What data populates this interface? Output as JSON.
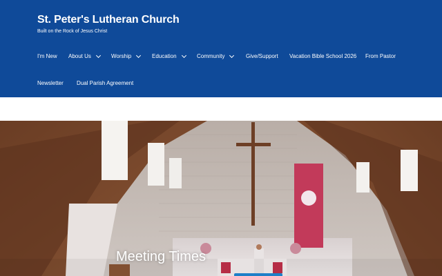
{
  "site": {
    "title": "St. Peter's Lutheran Church",
    "tagline": "Built on the Rock of Jesus Christ"
  },
  "nav": {
    "items": [
      {
        "label": "I'm New",
        "has_submenu": false
      },
      {
        "label": "About Us",
        "has_submenu": true
      },
      {
        "label": "Worship",
        "has_submenu": true
      },
      {
        "label": "Education",
        "has_submenu": true
      },
      {
        "label": "Community",
        "has_submenu": true
      },
      {
        "label": "Give/Support",
        "has_submenu": false
      },
      {
        "label": "Vacation Bible School 2026",
        "has_submenu": false
      },
      {
        "label": "From Pastor",
        "has_submenu": false
      },
      {
        "label": "Newsletter",
        "has_submenu": false
      },
      {
        "label": "Dual Parish Agreement",
        "has_submenu": false
      }
    ]
  },
  "hero": {
    "title": "Meeting Times",
    "image": "church-sanctuary-interior"
  },
  "colors": {
    "header_bg": "#0f4a99",
    "text_on_header": "#ffffff",
    "accent_button": "#1e7fc8"
  }
}
